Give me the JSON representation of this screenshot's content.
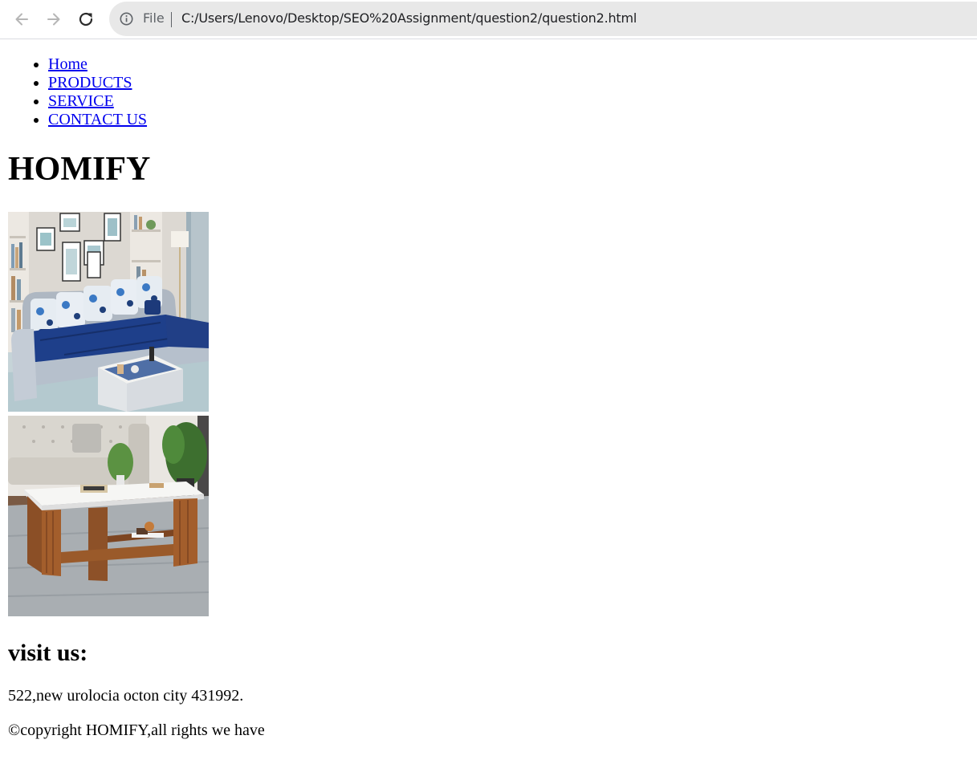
{
  "browser": {
    "back_icon": "arrow-left-icon",
    "forward_icon": "arrow-right-icon",
    "reload_icon": "reload-icon",
    "info_icon": "info-icon",
    "scheme_label": "File",
    "url": "C:/Users/Lenovo/Desktop/SEO%20Assignment/question2/question2.html"
  },
  "nav": {
    "items": [
      {
        "label": "Home"
      },
      {
        "label": "PRODUCTS"
      },
      {
        "label": "SERVICE"
      },
      {
        "label": "CONTACT US"
      }
    ],
    "link_color": "#0000ee"
  },
  "main": {
    "title": "HOMIFY",
    "images": [
      {
        "name": "sofa-product-image"
      },
      {
        "name": "coffee-table-product-image"
      }
    ]
  },
  "footer": {
    "visit_heading": "visit us:",
    "address": "522,new urolocia octon city 431992.",
    "copyright": "©copyright HOMIFY,all rights we have"
  }
}
